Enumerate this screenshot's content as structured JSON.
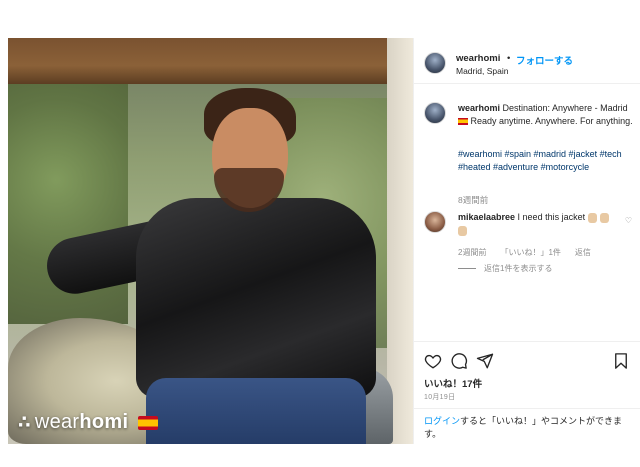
{
  "post": {
    "username": "wearhomi",
    "dot": "•",
    "follow_label": "フォローする",
    "location": "Madrid, Spain",
    "watermark_brand_light": "wear",
    "watermark_brand_bold": "homi",
    "caption": {
      "username": "wearhomi",
      "text_1": " Destination: Anywhere - Madrid ",
      "text_2": " Ready anytime. Anywhere. For anything.",
      "hashtags": "#wearhomi #spain #madrid #jacket #tech #heated #adventure #motorcycle",
      "time": "8週間前"
    },
    "comment": {
      "username": "mikaelaabree",
      "text": " I need this jacket",
      "time": "2週間前",
      "likes": "「いいね！」1件",
      "reply": "返信",
      "view_replies": "返信1件を表示する"
    },
    "likes_total": "いいね！17件",
    "date": "10月19日",
    "login": {
      "link": "ログイン",
      "text": "すると「いいね！」やコメントができます。"
    }
  },
  "icons": {
    "heart": "heart-icon",
    "comment": "comment-icon",
    "share": "share-icon",
    "save": "bookmark-icon"
  },
  "colors": {
    "link_blue": "#0095f6",
    "hashtag": "#00376b",
    "muted": "#8e8e8e",
    "text": "#262626"
  }
}
